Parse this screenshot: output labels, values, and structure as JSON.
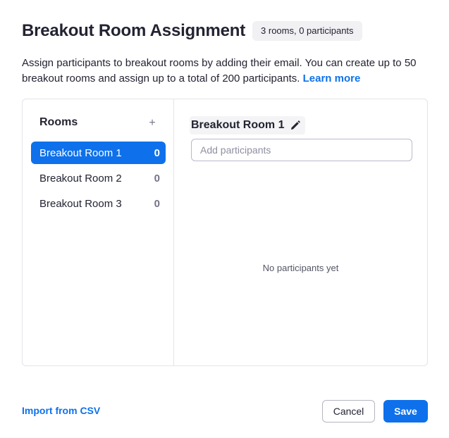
{
  "dialog": {
    "title": "Breakout Room Assignment",
    "summary_badge": "3 rooms, 0 participants",
    "description": "Assign participants to breakout rooms by adding their email. You can create up to 50 breakout rooms and assign up to a total of 200 participants.",
    "learn_more": "Learn more"
  },
  "rooms_panel": {
    "heading": "Rooms",
    "add_symbol": "+",
    "rooms": [
      {
        "name": "Breakout Room 1",
        "count": "0",
        "selected": true
      },
      {
        "name": "Breakout Room 2",
        "count": "0",
        "selected": false
      },
      {
        "name": "Breakout Room 3",
        "count": "0",
        "selected": false
      }
    ]
  },
  "detail": {
    "room_title": "Breakout Room 1",
    "edit_icon": "pencil-icon",
    "input_placeholder": "Add participants",
    "input_value": "",
    "empty_text": "No participants yet"
  },
  "footer": {
    "import_label": "Import from CSV",
    "cancel_label": "Cancel",
    "save_label": "Save"
  },
  "colors": {
    "accent": "#0e71eb",
    "text": "#232333",
    "muted": "#747487"
  }
}
